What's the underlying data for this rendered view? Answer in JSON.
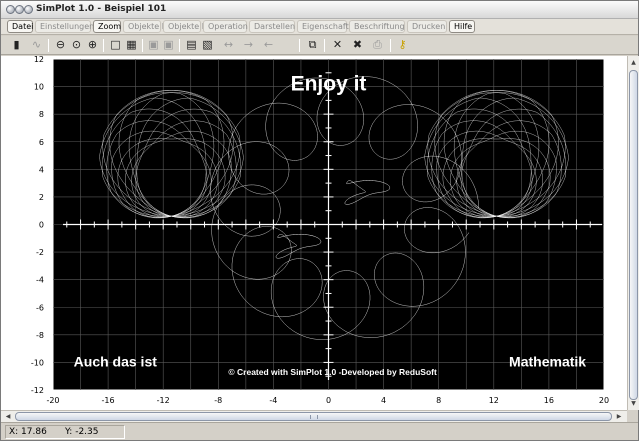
{
  "window": {
    "title": "SimPlot 1.0 - Beispiel 101"
  },
  "menu": {
    "items": [
      {
        "label": "Datei",
        "active": true
      },
      {
        "label": "Einstellungen",
        "active": false
      },
      {
        "label": "Zoom",
        "active": true
      },
      {
        "label": "Objekte I",
        "active": false
      },
      {
        "label": "Objekte II",
        "active": false
      },
      {
        "label": "Operation",
        "active": false
      },
      {
        "label": "Darstellen",
        "active": false
      },
      {
        "label": "Eigenschaft",
        "active": false
      },
      {
        "label": "Beschriftung",
        "active": false
      },
      {
        "label": "Drucken",
        "active": false
      },
      {
        "label": "Hilfe",
        "active": true
      }
    ]
  },
  "toolbar": {
    "icons": [
      "calculator-icon",
      "curve-icon",
      "zoom-icon",
      "zoom-out-icon",
      "zoom-in-icon",
      "box-icon",
      "grid-small-icon",
      "settings-icon",
      "settings-alt-icon",
      "table-icon",
      "image-icon",
      "arrow-left-icon",
      "arrow-right-icon",
      "arrow-back-icon",
      "copy-icon",
      "cross-icon",
      "delete-icon",
      "print-icon",
      "help-key-icon"
    ]
  },
  "plot": {
    "heading": "Enjoy it",
    "left_text": "Auch das ist",
    "right_text": "Mathematik",
    "credit": "© Created with SimPlot 1.0  -Developed by ReduSoft",
    "colors": {
      "background": "#000000",
      "curve": "#ffffff",
      "frame": "#ffffff"
    },
    "xlim": [
      -20,
      20
    ],
    "ylim": [
      -12,
      12
    ],
    "x_ticks": [
      "-20",
      "-16",
      "-12",
      "-8",
      "-4",
      "0",
      "4",
      "8",
      "12",
      "16",
      "20"
    ],
    "y_ticks": [
      "12",
      "10",
      "8",
      "6",
      "4",
      "2",
      "0",
      "-2",
      "-4",
      "-6",
      "-8",
      "-10",
      "-12"
    ]
  },
  "status": {
    "x_label": "X:  17.86",
    "y_label": "Y:  -2.35"
  }
}
